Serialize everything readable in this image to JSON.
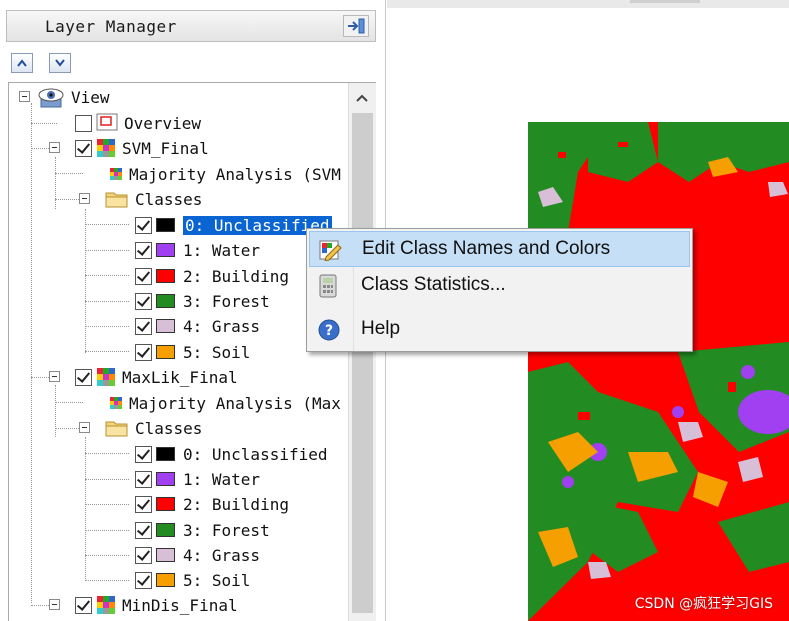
{
  "layer_manager": {
    "title": "Layer Manager",
    "pin_icon": "dock-pin-icon",
    "nav": {
      "up_icon": "chevron-up-icon",
      "down_icon": "chevron-down-icon"
    }
  },
  "tree": {
    "root": {
      "label": "View",
      "icon": "eye-icon"
    },
    "overview": {
      "label": "Overview",
      "checked": false
    },
    "layers": [
      {
        "label": "SVM_Final",
        "checked": true,
        "analysis_label": "Majority Analysis (SVM",
        "classes_label": "Classes",
        "classes": [
          {
            "label": "0: Unclassified",
            "color": "#000000",
            "checked": true,
            "selected": true
          },
          {
            "label": "1: Water",
            "color": "#a040f0",
            "checked": true
          },
          {
            "label": "2: Building",
            "color": "#ff0000",
            "checked": true
          },
          {
            "label": "3: Forest",
            "color": "#228b22",
            "checked": true
          },
          {
            "label": "4: Grass",
            "color": "#d8bfd8",
            "checked": true
          },
          {
            "label": "5: Soil",
            "color": "#f5a000",
            "checked": true
          }
        ]
      },
      {
        "label": "MaxLik_Final",
        "checked": true,
        "analysis_label": "Majority Analysis (Max",
        "classes_label": "Classes",
        "classes": [
          {
            "label": "0: Unclassified",
            "color": "#000000",
            "checked": true
          },
          {
            "label": "1: Water",
            "color": "#a040f0",
            "checked": true
          },
          {
            "label": "2: Building",
            "color": "#ff0000",
            "checked": true
          },
          {
            "label": "3: Forest",
            "color": "#228b22",
            "checked": true
          },
          {
            "label": "4: Grass",
            "color": "#d8bfd8",
            "checked": true
          },
          {
            "label": "5: Soil",
            "color": "#f5a000",
            "checked": true
          }
        ]
      },
      {
        "label": "MinDis_Final",
        "checked": true
      }
    ]
  },
  "context_menu": {
    "items": [
      {
        "label": "Edit Class Names and Colors",
        "icon": "edit-pencil-icon",
        "highlighted": true
      },
      {
        "label": "Class Statistics...",
        "icon": "calculator-icon"
      },
      {
        "label": "Help",
        "icon": "help-icon"
      }
    ]
  },
  "map": {
    "colors": {
      "building": "#ff0000",
      "forest": "#228b22",
      "water": "#a040f0",
      "grass": "#d8bfd8",
      "soil": "#f5a000"
    }
  },
  "watermark": "CSDN @疯狂学习GIS"
}
